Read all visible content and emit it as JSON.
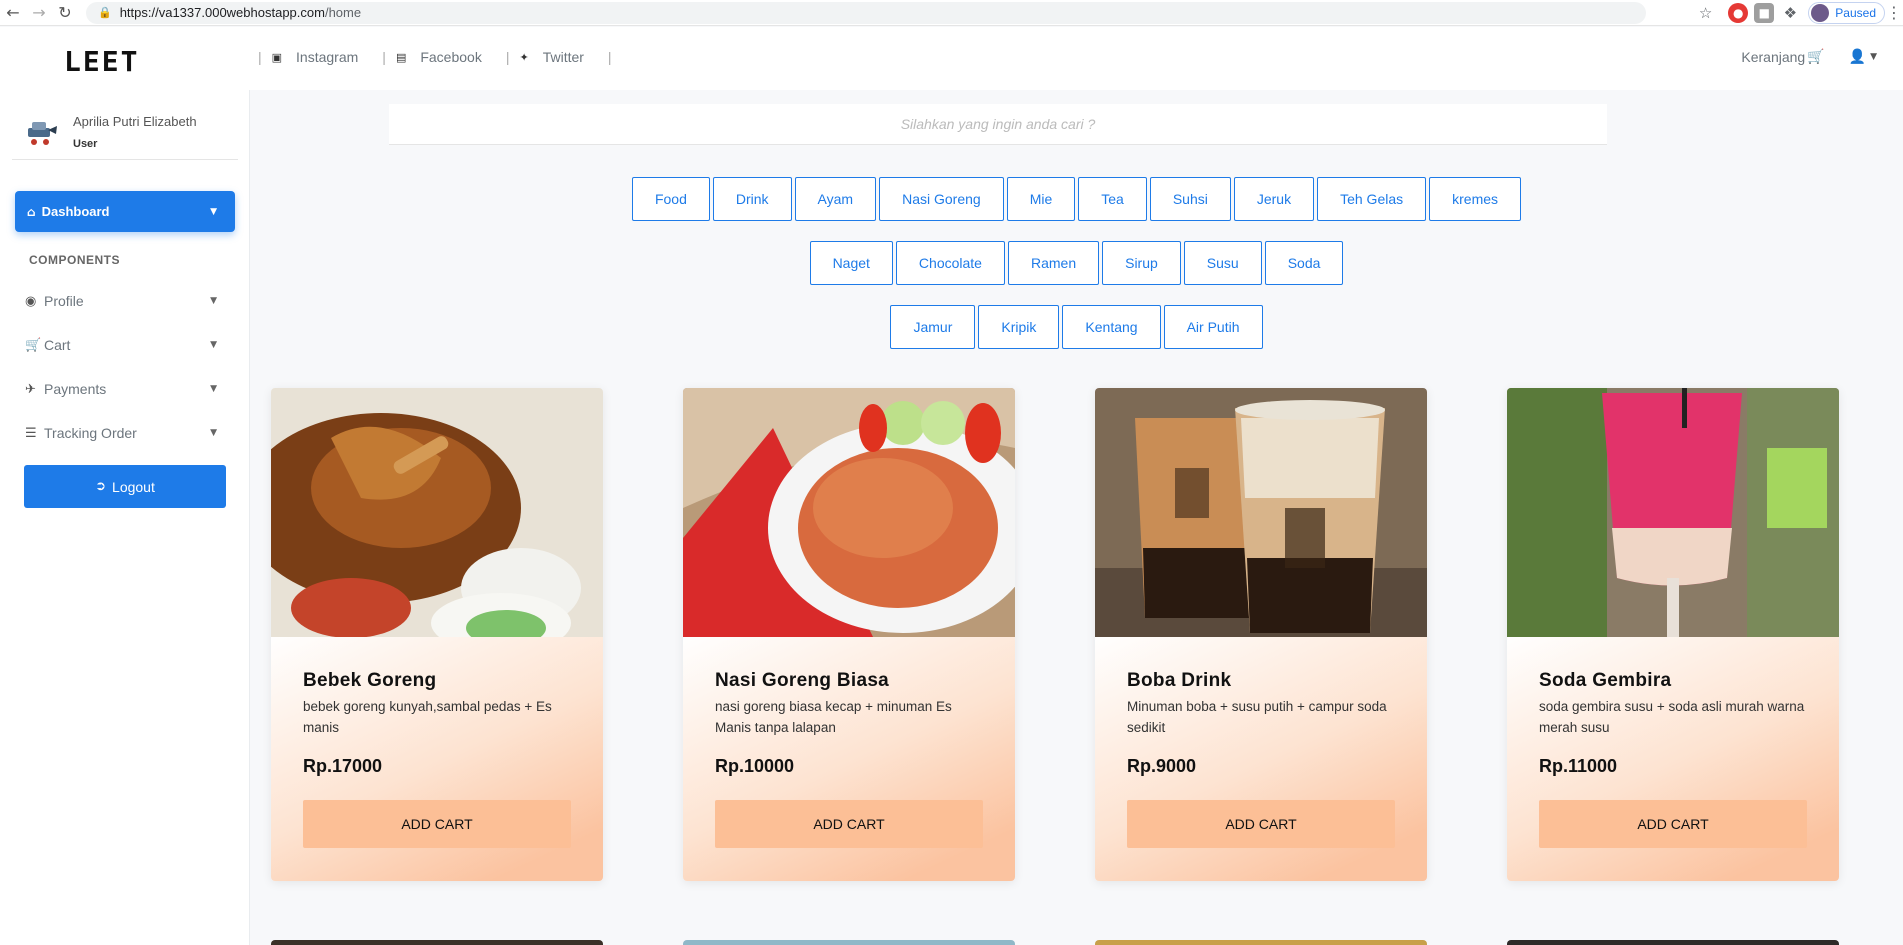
{
  "browser": {
    "url_host": "https://va1337.000webhostapp.com",
    "url_path": "/home",
    "profile_status": "Paused"
  },
  "navbar": {
    "logo": "LEET",
    "social": [
      {
        "label": "Instagram",
        "icon": "instagram-icon"
      },
      {
        "label": "Facebook",
        "icon": "facebook-icon"
      },
      {
        "label": "Twitter",
        "icon": "twitter-icon"
      }
    ],
    "cart_label": "Keranjang"
  },
  "sidebar": {
    "user_name": "Aprilia Putri Elizabeth",
    "user_role": "User",
    "dashboard_label": "Dashboard",
    "components_heading": "COMPONENTS",
    "items": [
      {
        "label": "Profile",
        "icon": "user-circle-icon"
      },
      {
        "label": "Cart",
        "icon": "cart-icon"
      },
      {
        "label": "Payments",
        "icon": "plane-icon"
      },
      {
        "label": "Tracking Order",
        "icon": "layers-icon"
      }
    ],
    "logout_label": "Logout"
  },
  "search": {
    "placeholder": "Silahkan yang ingin anda cari ?"
  },
  "categories": {
    "row1": [
      "Food",
      "Drink",
      "Ayam",
      "Nasi Goreng",
      "Mie",
      "Tea",
      "Suhsi",
      "Jeruk",
      "Teh Gelas",
      "kremes"
    ],
    "row2": [
      "Naget",
      "Chocolate",
      "Ramen",
      "Sirup",
      "Susu",
      "Soda"
    ],
    "row3": [
      "Jamur",
      "Kripik",
      "Kentang",
      "Air Putih"
    ]
  },
  "products": [
    {
      "name": "Bebek Goreng",
      "desc": "bebek goreng kunyah,sambal pedas + Es manis",
      "price": "Rp.17000",
      "button": "ADD CART"
    },
    {
      "name": "Nasi Goreng Biasa",
      "desc": "nasi goreng biasa kecap + minuman Es Manis tanpa lalapan",
      "price": "Rp.10000",
      "button": "ADD CART"
    },
    {
      "name": "Boba Drink",
      "desc": "Minuman boba + susu putih + campur soda sedikit",
      "price": "Rp.9000",
      "button": "ADD CART"
    },
    {
      "name": "Soda Gembira",
      "desc": "soda gembira susu + soda asli murah warna merah susu",
      "price": "Rp.11000",
      "button": "ADD CART"
    }
  ],
  "colors": {
    "primary": "#1e7be8",
    "card_button": "#fcbf96",
    "card_gradient_end": "#fbc3a0"
  }
}
